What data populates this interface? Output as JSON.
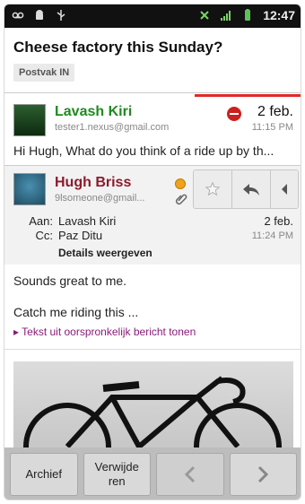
{
  "status_bar": {
    "time": "12:47",
    "left_icons": [
      "voicemail-icon",
      "android-icon",
      "usb-icon"
    ],
    "right_icons": [
      "sync-icon",
      "signal-icon",
      "battery-icon"
    ]
  },
  "thread": {
    "subject": "Cheese factory this Sunday?",
    "label": "Postvak IN"
  },
  "messages": [
    {
      "sender": "Lavash Kiri",
      "email": "tester1.nexus@gmail.com",
      "date": "2 feb.",
      "time": "11:15 PM",
      "snippet": "Hi Hugh, What do you think of a ride up by th..."
    },
    {
      "sender": "Hugh Briss",
      "email": "9lsomeone@gmail...",
      "to_label": "Aan:",
      "to": "Lavash Kiri",
      "cc_label": "Cc:",
      "cc": "Paz Ditu",
      "date": "2 feb.",
      "time": "11:24 PM",
      "details_label": "Details weergeven",
      "body_line1": "Sounds great to me.",
      "body_line2": "Catch me riding this ...",
      "show_quoted": "▸ Tekst uit oorspronkelijk bericht tonen"
    }
  ],
  "actions": {
    "archive": "Archief",
    "delete": "Verwijde\nren"
  },
  "colors": {
    "sender1": "#1f8a1f",
    "sender2": "#8b1b2c",
    "accent_line": "#e02a2a",
    "quoted_link": "#8a1b78"
  }
}
